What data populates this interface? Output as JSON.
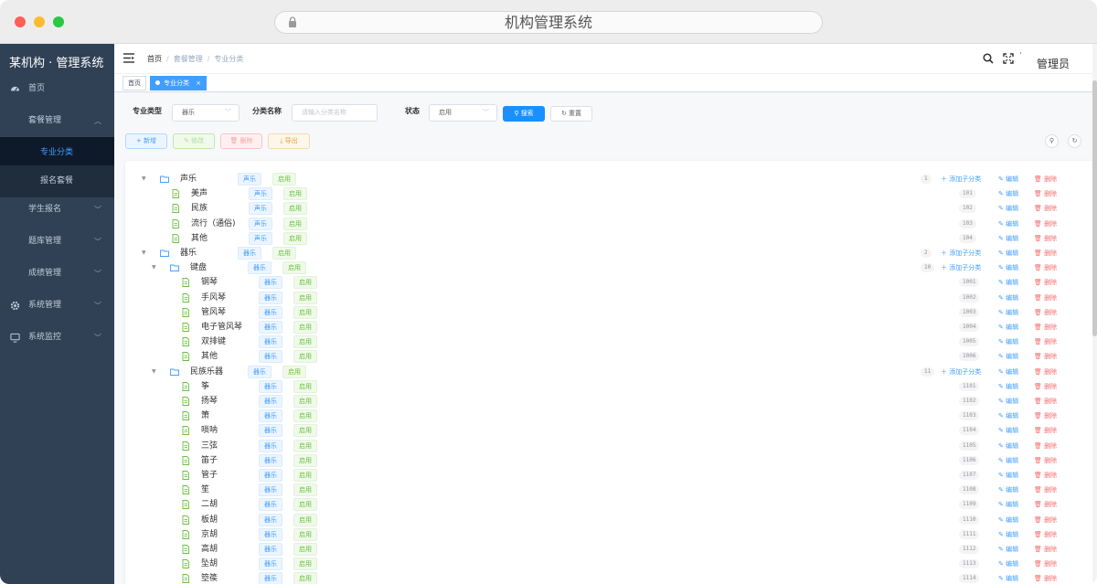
{
  "window": {
    "url_title": "机构管理系统",
    "dot_colors": [
      "#fe5f57",
      "#febc2e",
      "#28c840"
    ]
  },
  "sidebar": {
    "brand": "某机构 · 管理系统",
    "items": [
      {
        "label": "首页",
        "icon": "dashboard-icon",
        "active": false,
        "submenu": false
      },
      {
        "label": "套餐管理",
        "icon": "",
        "expanded": true,
        "submenu": true
      },
      {
        "label": "专业分类",
        "icon": "",
        "active": true,
        "child": true
      },
      {
        "label": "报名套餐",
        "icon": "",
        "active": false,
        "child": true
      },
      {
        "label": "学生报名",
        "icon": "",
        "submenu": true
      },
      {
        "label": "题库管理",
        "icon": "",
        "submenu": true
      },
      {
        "label": "成绩管理",
        "icon": "",
        "submenu": true
      },
      {
        "label": "系统管理",
        "icon": "gear-icon",
        "submenu": true
      },
      {
        "label": "系统监控",
        "icon": "monitor-icon",
        "submenu": true
      }
    ]
  },
  "navbar": {
    "breadcrumb": [
      "首页",
      "套餐管理",
      "专业分类"
    ],
    "user": "管理员",
    "dot": "·"
  },
  "tags": [
    {
      "label": "首页",
      "active": false
    },
    {
      "label": "专业分类",
      "active": true,
      "close": "×"
    }
  ],
  "filters": {
    "type_label": "专业类型",
    "type_value": "器乐",
    "name_label": "分类名称",
    "name_placeholder": "请输入分类名称",
    "status_label": "状态",
    "status_value": "启用",
    "search_btn": "搜索",
    "reset_btn": "重置"
  },
  "toolbar": {
    "add": "新增",
    "edit": "修改",
    "delete": "删除",
    "export": "导出"
  },
  "row_actions": {
    "add_child": "添加子分类",
    "edit": "编辑",
    "delete": "删除"
  },
  "tree": [
    {
      "level": 0,
      "folder": true,
      "expanded": true,
      "name": "声乐",
      "type": "声乐",
      "status": "启用",
      "code": "1",
      "add_child": true
    },
    {
      "level": 1,
      "folder": false,
      "name": "美声",
      "type": "声乐",
      "status": "启用",
      "code": "101"
    },
    {
      "level": 1,
      "folder": false,
      "name": "民族",
      "type": "声乐",
      "status": "启用",
      "code": "102"
    },
    {
      "level": 1,
      "folder": false,
      "name": "流行（通俗)",
      "type": "声乐",
      "status": "启用",
      "code": "103"
    },
    {
      "level": 1,
      "folder": false,
      "name": "其他",
      "type": "声乐",
      "status": "启用",
      "code": "104"
    },
    {
      "level": 0,
      "folder": true,
      "expanded": true,
      "name": "器乐",
      "type": "器乐",
      "status": "启用",
      "code": "2",
      "add_child": true
    },
    {
      "level": 1,
      "folder": true,
      "expanded": true,
      "name": "键盘",
      "type": "器乐",
      "status": "启用",
      "code": "10",
      "add_child": true
    },
    {
      "level": 2,
      "folder": false,
      "name": "钢琴",
      "type": "器乐",
      "status": "启用",
      "code": "1001"
    },
    {
      "level": 2,
      "folder": false,
      "name": "手风琴",
      "type": "器乐",
      "status": "启用",
      "code": "1002"
    },
    {
      "level": 2,
      "folder": false,
      "name": "管风琴",
      "type": "器乐",
      "status": "启用",
      "code": "1003"
    },
    {
      "level": 2,
      "folder": false,
      "name": "电子管风琴",
      "type": "器乐",
      "status": "启用",
      "code": "1004"
    },
    {
      "level": 2,
      "folder": false,
      "name": "双排键",
      "type": "器乐",
      "status": "启用",
      "code": "1005"
    },
    {
      "level": 2,
      "folder": false,
      "name": "其他",
      "type": "器乐",
      "status": "启用",
      "code": "1006"
    },
    {
      "level": 1,
      "folder": true,
      "expanded": true,
      "name": "民族乐器",
      "type": "器乐",
      "status": "启用",
      "code": "11",
      "add_child": true
    },
    {
      "level": 2,
      "folder": false,
      "name": "筝",
      "type": "器乐",
      "status": "启用",
      "code": "1101"
    },
    {
      "level": 2,
      "folder": false,
      "name": "扬琴",
      "type": "器乐",
      "status": "启用",
      "code": "1102"
    },
    {
      "level": 2,
      "folder": false,
      "name": "箫",
      "type": "器乐",
      "status": "启用",
      "code": "1103"
    },
    {
      "level": 2,
      "folder": false,
      "name": "唢呐",
      "type": "器乐",
      "status": "启用",
      "code": "1104"
    },
    {
      "level": 2,
      "folder": false,
      "name": "三弦",
      "type": "器乐",
      "status": "启用",
      "code": "1105"
    },
    {
      "level": 2,
      "folder": false,
      "name": "笛子",
      "type": "器乐",
      "status": "启用",
      "code": "1106"
    },
    {
      "level": 2,
      "folder": false,
      "name": "管子",
      "type": "器乐",
      "status": "启用",
      "code": "1107"
    },
    {
      "level": 2,
      "folder": false,
      "name": "笙",
      "type": "器乐",
      "status": "启用",
      "code": "1108"
    },
    {
      "level": 2,
      "folder": false,
      "name": "二胡",
      "type": "器乐",
      "status": "启用",
      "code": "1109"
    },
    {
      "level": 2,
      "folder": false,
      "name": "板胡",
      "type": "器乐",
      "status": "启用",
      "code": "1110"
    },
    {
      "level": 2,
      "folder": false,
      "name": "京胡",
      "type": "器乐",
      "status": "启用",
      "code": "1111"
    },
    {
      "level": 2,
      "folder": false,
      "name": "高胡",
      "type": "器乐",
      "status": "启用",
      "code": "1112"
    },
    {
      "level": 2,
      "folder": false,
      "name": "坠胡",
      "type": "器乐",
      "status": "启用",
      "code": "1113"
    },
    {
      "level": 2,
      "folder": false,
      "name": "箜篌",
      "type": "器乐",
      "status": "启用",
      "code": "1114"
    }
  ]
}
